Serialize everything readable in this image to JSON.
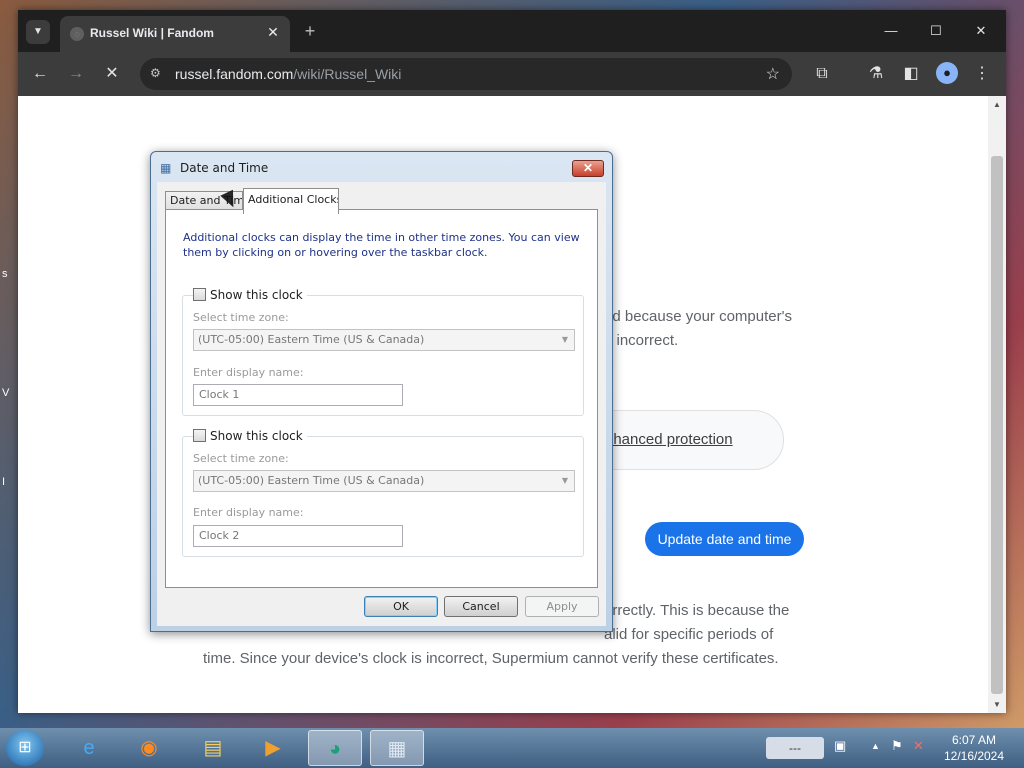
{
  "browser": {
    "tab_title": "Russel Wiki | Fandom",
    "new_tab_label": "+",
    "url_host": "russel.fandom.com",
    "url_path": "/wiki/Russel_Wiki"
  },
  "page": {
    "para1_line1": "ed because your computer's",
    "para1_line2": "e incorrect.",
    "protection_link": "nhanced protection",
    "update_button": "Update date and time",
    "para2_line1": "orrectly. This is because the",
    "para2_line2": "alid for specific periods of",
    "para2_line3": "time. Since your device's clock is incorrect, Supermium cannot verify these certificates."
  },
  "dialog": {
    "title": "Date and Time",
    "tabs": [
      "Date and Time",
      "Additional Clocks"
    ],
    "description": "Additional clocks can display the time in other time zones. You can view them by clicking on or hovering over the taskbar clock.",
    "clocks": [
      {
        "checkbox_label": "Show this clock",
        "timezone_label": "Select time zone:",
        "timezone_value": "(UTC-05:00) Eastern Time (US & Canada)",
        "name_label": "Enter display name:",
        "name_value": "Clock 1"
      },
      {
        "checkbox_label": "Show this clock",
        "timezone_label": "Select time zone:",
        "timezone_value": "(UTC-05:00) Eastern Time (US & Canada)",
        "name_label": "Enter display name:",
        "name_value": "Clock 2"
      }
    ],
    "ok_label": "OK",
    "cancel_label": "Cancel",
    "apply_label": "Apply"
  },
  "taskbar": {
    "keyboard_indicator": "---",
    "time": "6:07 AM",
    "date": "12/16/2024"
  },
  "colors": {
    "accent": "#1a73e8",
    "chrome_dark": "#3c3c3c"
  }
}
